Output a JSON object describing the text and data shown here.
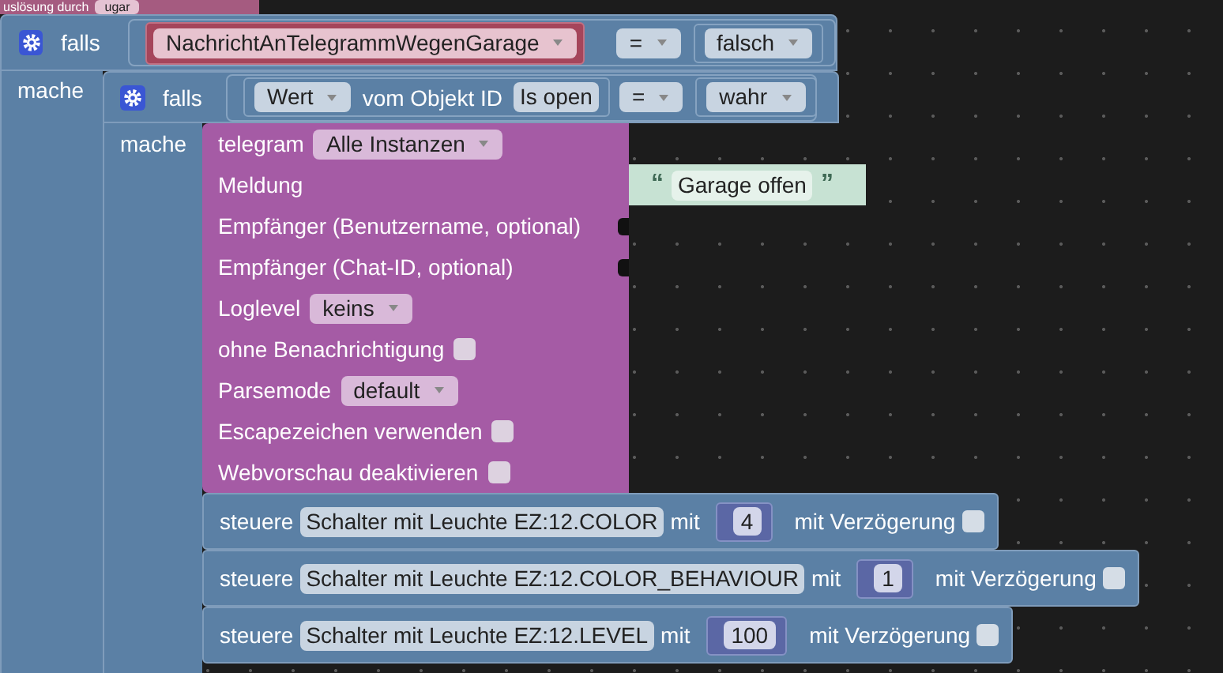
{
  "event_block": {
    "label": "uslösung durch",
    "field": "ugar"
  },
  "outer_if": {
    "label": "falls",
    "do_label": "mache",
    "condition": {
      "variable": "NachrichtAnTelegrammWegenGarage",
      "operator": "=",
      "value": "falsch"
    }
  },
  "inner_if": {
    "label": "falls",
    "do_label": "mache",
    "condition": {
      "property": "Wert",
      "text": "vom Objekt ID",
      "object": "Is open",
      "operator": "=",
      "value": "wahr"
    }
  },
  "telegram": {
    "title": "telegram",
    "instance": "Alle Instanzen",
    "rows": [
      {
        "kind": "text_input",
        "label": "Meldung",
        "open_quote": "“",
        "value": "Garage offen",
        "close_quote": "”"
      },
      {
        "kind": "input",
        "label": "Empfänger (Benutzername, optional)"
      },
      {
        "kind": "input",
        "label": "Empfänger (Chat-ID, optional)"
      },
      {
        "kind": "dropdown",
        "label": "Loglevel",
        "value": "keins"
      },
      {
        "kind": "checkbox",
        "label": "ohne Benachrichtigung",
        "checked": false
      },
      {
        "kind": "dropdown",
        "label": "Parsemode",
        "value": "default"
      },
      {
        "kind": "checkbox",
        "label": "Escapezeichen verwenden",
        "checked": false
      },
      {
        "kind": "checkbox",
        "label": "Webvorschau deaktivieren",
        "checked": false
      }
    ]
  },
  "control_blocks": [
    {
      "label": "steuere",
      "object": "Schalter mit Leuchte EZ:12.COLOR",
      "with_label": "mit",
      "value": "4",
      "delay_label": "mit Verzögerung",
      "delay": false
    },
    {
      "label": "steuere",
      "object": "Schalter mit Leuchte EZ:12.COLOR_BEHAVIOUR",
      "with_label": "mit",
      "value": "1",
      "delay_label": "mit Verzögerung",
      "delay": false
    },
    {
      "label": "steuere",
      "object": "Schalter mit Leuchte EZ:12.LEVEL",
      "with_label": "mit",
      "value": "100",
      "delay_label": "mit Verzögerung",
      "delay": false
    }
  ]
}
